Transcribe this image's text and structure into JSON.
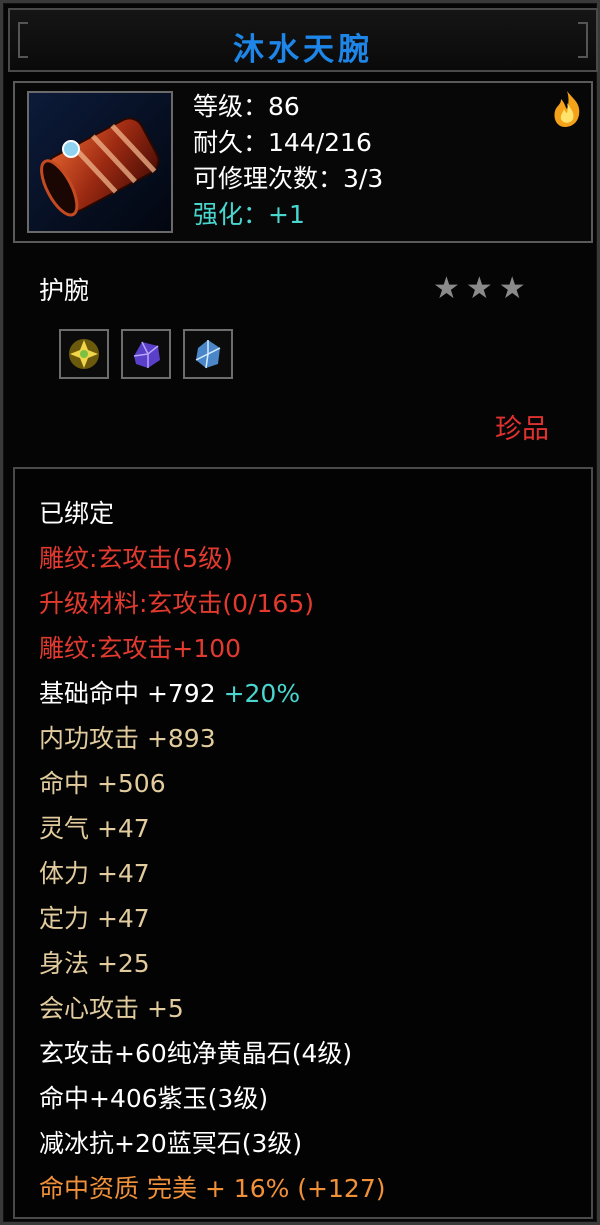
{
  "item": {
    "name": "沐水天腕",
    "stats": {
      "level": "等级：86",
      "durability": "耐久：144/216",
      "repairs": "可修理次数：3/3",
      "enhance": "强化：+1"
    },
    "type": "护腕",
    "stars": "★★★",
    "quality": "珍品",
    "icon": "bracer-icon",
    "gem_icons": [
      "gold-gem-icon",
      "purple-gem-icon",
      "blue-gem-icon"
    ]
  },
  "attributes": {
    "bound": "已绑定",
    "engrave": "雕纹:玄攻击(5级)",
    "upgrade_material": "升级材料:玄攻击(0/165)",
    "engrave_bonus": "雕纹:玄攻击+100",
    "base_hit": {
      "text": "基础命中  +792 ",
      "bonus": "+20%"
    },
    "lines": [
      "内功攻击  +893",
      "命中  +506",
      "灵气  +47",
      "体力  +47",
      "定力  +47",
      "身法  +25",
      "会心攻击  +5"
    ],
    "gems": [
      "玄攻击+60纯净黄晶石(4级)",
      "命中+406紫玉(3级)",
      "减冰抗+20蓝冥石(3级)"
    ],
    "aptitude": "命中资质  完美  + 16% (+127)"
  },
  "colors": {
    "title": "#1e86e8",
    "cyan": "#49d6cf",
    "red": "#e23a2f",
    "tan": "#e2cc9e",
    "orange": "#f0913a"
  }
}
